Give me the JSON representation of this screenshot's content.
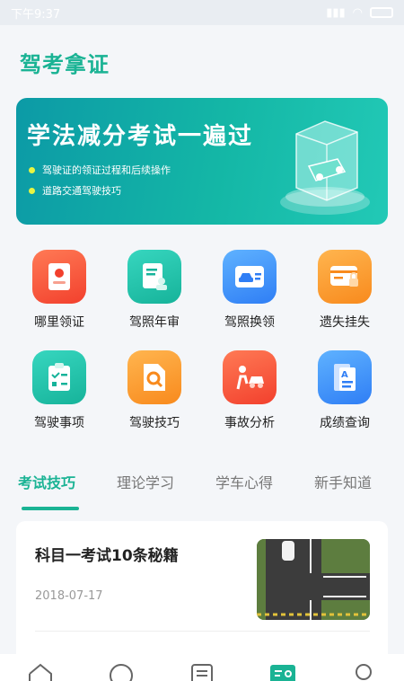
{
  "status_bar": {
    "time": "下午9:37"
  },
  "page": {
    "title": "驾考拿证"
  },
  "banner": {
    "title": "学法减分考试一遍过",
    "points": [
      "驾驶证的领证过程和后续操作",
      "道路交通驾驶技巧"
    ]
  },
  "services": [
    {
      "label": "哪里领证",
      "icon": "license-badge-icon",
      "color": "red"
    },
    {
      "label": "驾照年审",
      "icon": "document-person-icon",
      "color": "teal"
    },
    {
      "label": "驾照换领",
      "icon": "car-card-icon",
      "color": "blue"
    },
    {
      "label": "遗失挂失",
      "icon": "card-lock-icon",
      "color": "orange"
    },
    {
      "label": "驾驶事项",
      "icon": "checklist-icon",
      "color": "teal"
    },
    {
      "label": "驾驶技巧",
      "icon": "search-doc-icon",
      "color": "orange"
    },
    {
      "label": "事故分析",
      "icon": "accident-icon",
      "color": "red"
    },
    {
      "label": "成绩查询",
      "icon": "report-icon",
      "color": "blue"
    }
  ],
  "tabs": [
    {
      "label": "考试技巧",
      "active": true
    },
    {
      "label": "理论学习",
      "active": false
    },
    {
      "label": "学车心得",
      "active": false
    },
    {
      "label": "新手知道",
      "active": false
    }
  ],
  "article": {
    "title": "科目一考试10条秘籍",
    "date": "2018-07-17"
  },
  "bottom_nav": [
    {
      "icon": "home-icon"
    },
    {
      "icon": "chat-icon"
    },
    {
      "icon": "list-icon"
    },
    {
      "icon": "guide-icon",
      "active": true
    },
    {
      "icon": "profile-icon"
    }
  ],
  "colors": {
    "accent": "#1ab394"
  }
}
